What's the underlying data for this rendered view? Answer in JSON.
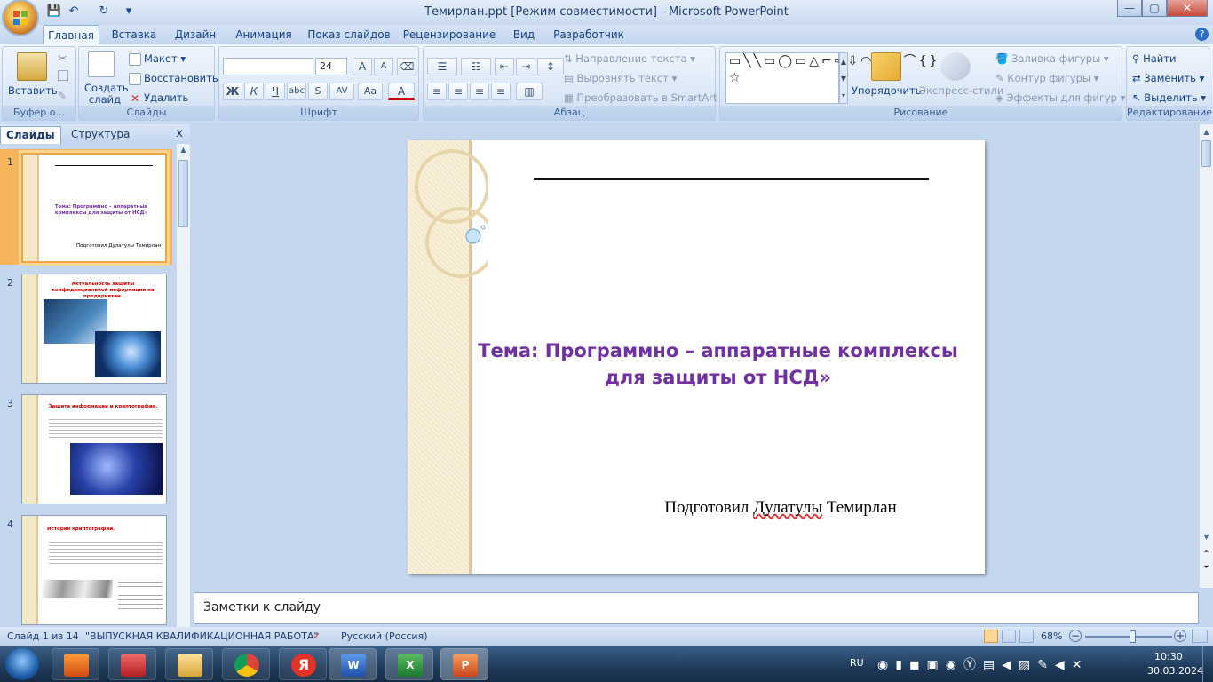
{
  "window": {
    "title": "Темирлан.ppt [Режим совместимости] - Microsoft PowerPoint",
    "min": "—",
    "max": "▢",
    "close": "✕"
  },
  "qat": {
    "save": "💾",
    "undo": "↶",
    "redo": "↻",
    "more": "▾"
  },
  "tabs": [
    "Главная",
    "Вставка",
    "Дизайн",
    "Анимация",
    "Показ слайдов",
    "Рецензирование",
    "Вид",
    "Разработчик"
  ],
  "help": "?",
  "ribbon": {
    "clipboard": {
      "paste": "Вставить",
      "label": "Буфер о..."
    },
    "slides": {
      "create": "Создать слайд",
      "layout": "Макет",
      "reset": "Восстановить",
      "delete": "Удалить",
      "label": "Слайды"
    },
    "font": {
      "size": "24",
      "bold": "Ж",
      "italic": "К",
      "underline": "Ч",
      "strike": "abc",
      "spacing": "AV",
      "case": "Aa",
      "color": "A",
      "label": "Шрифт"
    },
    "paragraph": {
      "direction": "Направление текста",
      "align": "Выровнять текст",
      "smartart": "Преобразовать в SmartArt",
      "label": "Абзац"
    },
    "drawing": {
      "shapes": "▭╲╲▭◯▭△⌐⇨⇩◠▭⌒⌒{}☆",
      "arrange": "Упорядочить",
      "quickstyles": "Экспресс-стили",
      "fill": "Заливка фигуры",
      "outline": "Контур фигуры",
      "effects": "Эффекты для фигур",
      "label": "Рисование"
    },
    "editing": {
      "find": "Найти",
      "replace": "Заменить",
      "select": "Выделить",
      "label": "Редактирование"
    }
  },
  "leftpanel": {
    "tab_slides": "Слайды",
    "tab_outline": "Структура",
    "close": "x"
  },
  "thumbnails": [
    {
      "num": "1",
      "title": "Тема: Программно – аппаратные  комплексы  для защиты  от НСД»",
      "author": "Подготовил Дулатулы Темирлан"
    },
    {
      "num": "2",
      "title": "Актуальность защиты конфиденциальной информации на предприятии."
    },
    {
      "num": "3",
      "title": "Защита информации и криптография."
    },
    {
      "num": "4",
      "title": "История криптографии."
    }
  ],
  "slide": {
    "title": "Тема: Программно – аппаратные комплексы для защиты  от НСД»",
    "author_prefix": "Подготовил ",
    "author_surname": "Дулатулы",
    "author_name": " Темирлан"
  },
  "notes": {
    "placeholder": "Заметки к слайду"
  },
  "status": {
    "slide": "Слайд 1 из 14",
    "theme": "\"ВЫПУСКНАЯ КВАЛИФИКАЦИОННАЯ РАБОТА\"",
    "language": "Русский (Россия)",
    "zoom": "68%",
    "zoom_fraction": 0.55
  },
  "tray": {
    "lang": "RU",
    "time": "10:30",
    "date": "30.03.2024"
  }
}
